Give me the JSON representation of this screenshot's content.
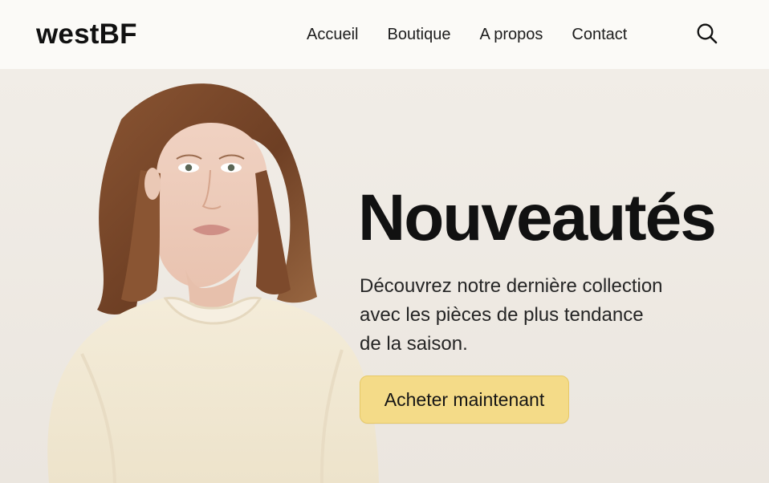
{
  "header": {
    "logo": "westBF",
    "nav": [
      "Accueil",
      "Boutique",
      "A propos",
      "Contact"
    ],
    "search_icon": "search-icon"
  },
  "hero": {
    "title": "Nouveautés",
    "description": [
      "Découvrez notre dernière collection",
      "avec les pièces de plus tendance",
      "de la saison."
    ],
    "cta_label": "Acheter maintenant",
    "photo_icon": "woman-portrait"
  },
  "colors": {
    "header_background": "#fbfaf7",
    "hero_background": "#efebe5",
    "button_background": "#f4db88",
    "text_primary": "#111111"
  }
}
